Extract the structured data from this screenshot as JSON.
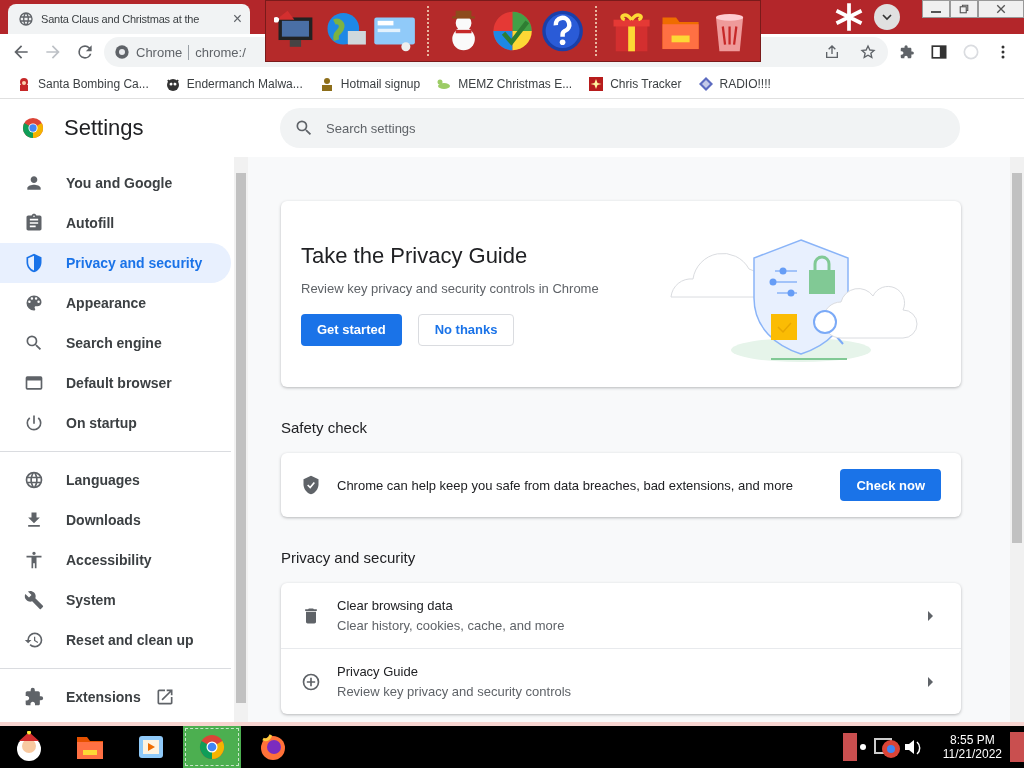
{
  "browser": {
    "tab": {
      "title": "Santa Claus and Christmas at the",
      "close": "×"
    },
    "omnibox": {
      "site": "Chrome",
      "url": "chrome:/"
    },
    "bookmarks": [
      {
        "label": "Santa Bombing Ca..."
      },
      {
        "label": "Endermanch Malwa..."
      },
      {
        "label": "Hotmail signup"
      },
      {
        "label": "MEMZ Christmas E..."
      },
      {
        "label": "Chris Tracker"
      },
      {
        "label": "RADIO!!!!"
      }
    ]
  },
  "settings": {
    "title": "Settings",
    "search": {
      "placeholder": "Search settings"
    },
    "sidebar": {
      "groups": [
        {
          "items": [
            {
              "label": "You and Google",
              "selected": false,
              "kind": "page"
            },
            {
              "label": "Autofill",
              "selected": false,
              "kind": "page"
            },
            {
              "label": "Privacy and security",
              "selected": true,
              "kind": "page"
            },
            {
              "label": "Appearance",
              "selected": false,
              "kind": "page"
            },
            {
              "label": "Search engine",
              "selected": false,
              "kind": "page"
            },
            {
              "label": "Default browser",
              "selected": false,
              "kind": "page"
            },
            {
              "label": "On startup",
              "selected": false,
              "kind": "page"
            }
          ]
        },
        {
          "items": [
            {
              "label": "Languages",
              "selected": false,
              "kind": "page"
            },
            {
              "label": "Downloads",
              "selected": false,
              "kind": "page"
            },
            {
              "label": "Accessibility",
              "selected": false,
              "kind": "page"
            },
            {
              "label": "System",
              "selected": false,
              "kind": "page"
            },
            {
              "label": "Reset and clean up",
              "selected": false,
              "kind": "page"
            }
          ]
        },
        {
          "items": [
            {
              "label": "Extensions",
              "selected": false,
              "kind": "link"
            }
          ]
        }
      ]
    }
  },
  "privacy_guide": {
    "title": "Take the Privacy Guide",
    "text": "Review key privacy and security controls in Chrome",
    "buttons": [
      {
        "label": "Get started",
        "kind": "primary"
      },
      {
        "label": "No thanks",
        "kind": "secondary"
      }
    ]
  },
  "safety_check": {
    "heading": "Safety check",
    "text": "Chrome can help keep you safe from data breaches, bad extensions, and more",
    "button": "Check now"
  },
  "privacy_section": {
    "heading": "Privacy and security",
    "rows": [
      {
        "title": "Clear browsing data",
        "subtitle": "Clear history, cookies, cache, and more"
      },
      {
        "title": "Privacy Guide",
        "subtitle": "Review key privacy and security controls"
      }
    ]
  },
  "taskbar": {
    "apps": [
      {
        "selected": false
      },
      {
        "selected": false
      },
      {
        "selected": false
      },
      {
        "selected": true
      },
      {
        "selected": false
      }
    ],
    "time": "8:55 PM",
    "date": "11/21/2022"
  }
}
